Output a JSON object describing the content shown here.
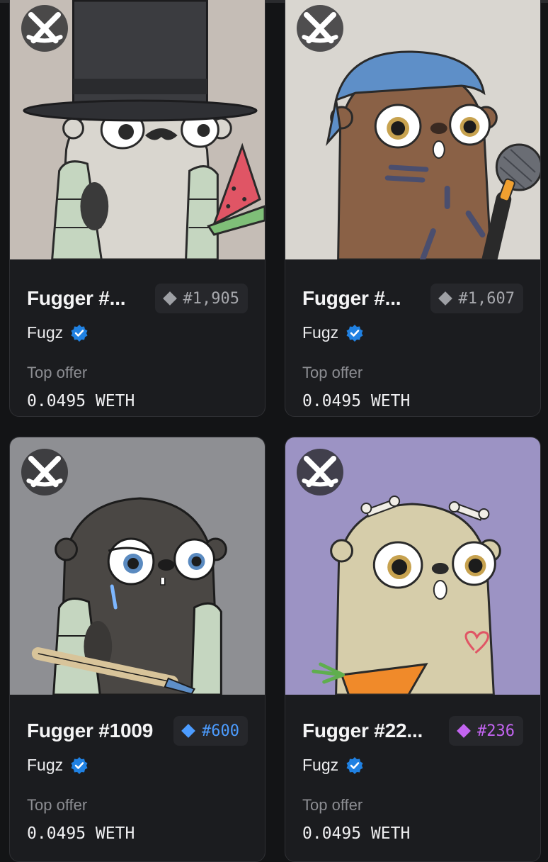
{
  "cards": [
    {
      "title": "Fugger #...",
      "rank": "#1,905",
      "rank_color": "#9ea0a5",
      "collection": "Fugz",
      "offer_label": "Top offer",
      "offer_value": "0.0495 WETH",
      "image_background": "#c5bdb6",
      "chain_icon": "chain-logo-icon"
    },
    {
      "title": "Fugger #...",
      "rank": "#1,607",
      "rank_color": "#9ea0a5",
      "collection": "Fugz",
      "offer_label": "Top offer",
      "offer_value": "0.0495 WETH",
      "image_background": "#d9d6d0",
      "chain_icon": "chain-logo-icon"
    },
    {
      "title": "Fugger #1009",
      "rank": "#600",
      "rank_color": "#4c9cff",
      "collection": "Fugz",
      "offer_label": "Top offer",
      "offer_value": "0.0495 WETH",
      "image_background": "#8e8f93",
      "chain_icon": "chain-logo-icon"
    },
    {
      "title": "Fugger #22...",
      "rank": "#236",
      "rank_color": "#c264f0",
      "collection": "Fugz",
      "offer_label": "Top offer",
      "offer_value": "0.0495 WETH",
      "image_background": "#9c93c4",
      "chain_icon": "chain-logo-icon"
    }
  ],
  "theme": {
    "page_background": "#131416",
    "card_background": "#1b1c1f",
    "verified_color": "#2081e2"
  }
}
